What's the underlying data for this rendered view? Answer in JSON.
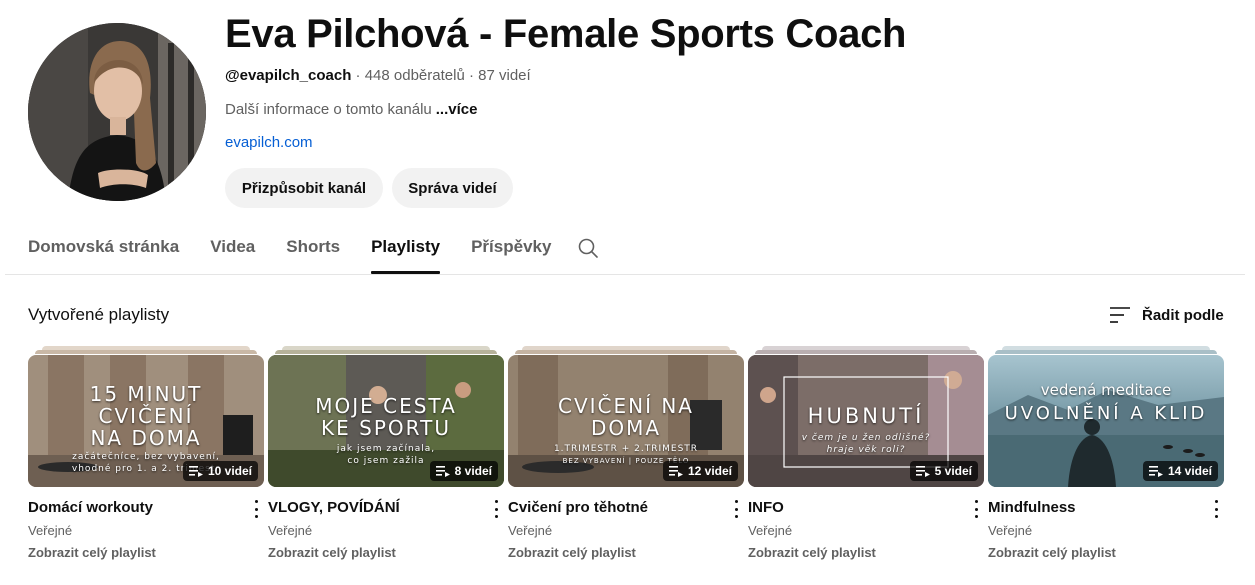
{
  "channel": {
    "title": "Eva Pilchová - Female Sports Coach",
    "handle": "@evapilch_coach",
    "subscribers": "448 odběratelů",
    "videos": "87 videí",
    "separator": "·",
    "description": "Další informace o tomto kanálu",
    "more_label": "...více",
    "link": "evapilch.com"
  },
  "buttons": {
    "customize": "Přizpůsobit kanál",
    "manage": "Správa videí"
  },
  "tabs": [
    {
      "label": "Domovská stránka",
      "active": false
    },
    {
      "label": "Videa",
      "active": false
    },
    {
      "label": "Shorts",
      "active": false
    },
    {
      "label": "Playlisty",
      "active": true
    },
    {
      "label": "Příspěvky",
      "active": false
    }
  ],
  "section": {
    "title": "Vytvořené playlisty",
    "sort_label": "Řadit podle"
  },
  "playlists": [
    {
      "title": "Domácí workouty",
      "visibility": "Veřejné",
      "link": "Zobrazit celý playlist",
      "count": "10 videí",
      "thumb_big": [
        "15 MINUT",
        "CVIČENÍ",
        "NA DOMA"
      ],
      "thumb_small": [
        "začátečníce, bez vybavení,",
        "vhodné pro 1. a 2. trimestr"
      ],
      "colors": {
        "bg": "#9b8a78",
        "stack1": "#c9b8a6",
        "stack2": "#e2d6c9"
      }
    },
    {
      "title": "VLOGY, POVÍDÁNÍ",
      "visibility": "Veřejné",
      "link": "Zobrazit celý playlist",
      "count": "8 videí",
      "thumb_big": [
        "MOJE CESTA",
        "KE SPORTU"
      ],
      "thumb_small": [
        "jak jsem začínala,",
        "co jsem zažila"
      ],
      "colors": {
        "bg": "#6f7050",
        "stack1": "#b6b29a",
        "stack2": "#d9d6c8"
      }
    },
    {
      "title": "Cvičení pro těhotné",
      "visibility": "Veřejné",
      "link": "Zobrazit celý playlist",
      "count": "12 videí",
      "thumb_big": [
        "CVIČENÍ NA",
        "DOMA"
      ],
      "thumb_small": [
        "1.TRIMESTR + 2.TRIMESTR",
        "BEZ VYBAVENÍ | POUZE TĚLO"
      ],
      "colors": {
        "bg": "#8d7c6c",
        "stack1": "#c4b3a2",
        "stack2": "#e0d5ca"
      }
    },
    {
      "title": "INFO",
      "visibility": "Veřejné",
      "link": "Zobrazit celý playlist",
      "count": "5 videí",
      "thumb_big": [
        "HUBNUTÍ"
      ],
      "thumb_small": [
        "v čem je u žen odlišné?",
        "hraje věk roli?"
      ],
      "colors": {
        "bg": "#7a6a66",
        "stack1": "#b9aeb0",
        "stack2": "#d8d2d4"
      }
    },
    {
      "title": "Mindfulness",
      "visibility": "Veřejné",
      "link": "Zobrazit celý playlist",
      "count": "14 videí",
      "thumb_big_top": "vedená meditace",
      "thumb_big": [
        "UVOLNĚNÍ A KLID"
      ],
      "thumb_small": [],
      "colors": {
        "bg": "#5d7e8a",
        "stack1": "#a9bfc7",
        "stack2": "#d1dde1"
      }
    }
  ],
  "icons": {
    "search": "search-icon",
    "sort": "sort-icon",
    "playlist": "playlist-icon",
    "menu": "more-vert-icon"
  }
}
